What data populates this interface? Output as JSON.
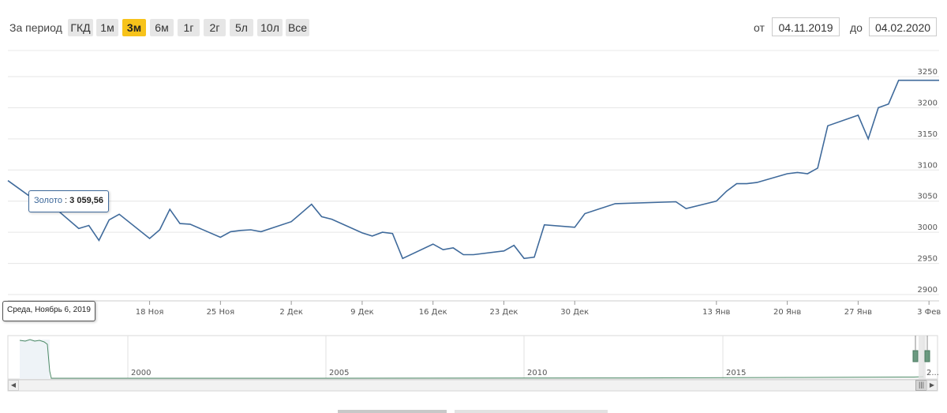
{
  "toolbar": {
    "period_label": "За период",
    "ranges": [
      {
        "label": "ГКД",
        "active": false
      },
      {
        "label": "1м",
        "active": false
      },
      {
        "label": "3м",
        "active": true
      },
      {
        "label": "6м",
        "active": false
      },
      {
        "label": "1г",
        "active": false
      },
      {
        "label": "2г",
        "active": false
      },
      {
        "label": "5л",
        "active": false
      },
      {
        "label": "10л",
        "active": false
      },
      {
        "label": "Все",
        "active": false
      }
    ],
    "from_label": "от",
    "from_value": "04.11.2019",
    "to_label": "до",
    "to_value": "04.02.2020"
  },
  "tooltip": {
    "series_name": "Золото",
    "separator": " : ",
    "value": "3 059,56",
    "date": "Среда, Ноябрь 6, 2019"
  },
  "colors": {
    "line": "#3f6a9b",
    "active_button": "#f7c31a",
    "navigator_line": "#4d8a67"
  },
  "chart_data": {
    "type": "line",
    "series": [
      {
        "name": "Золото",
        "x": [
          "04.11.2019",
          "06.11.2019",
          "07.11.2019",
          "08.11.2019",
          "11.11.2019",
          "12.11.2019",
          "13.11.2019",
          "14.11.2019",
          "15.11.2019",
          "18.11.2019",
          "19.11.2019",
          "20.11.2019",
          "21.11.2019",
          "22.11.2019",
          "25.11.2019",
          "26.11.2019",
          "27.11.2019",
          "28.11.2019",
          "29.11.2019",
          "02.12.2019",
          "03.12.2019",
          "04.12.2019",
          "05.12.2019",
          "06.12.2019",
          "09.12.2019",
          "10.12.2019",
          "11.12.2019",
          "12.12.2019",
          "13.12.2019",
          "16.12.2019",
          "17.12.2019",
          "18.12.2019",
          "19.12.2019",
          "20.12.2019",
          "23.12.2019",
          "24.12.2019",
          "25.12.2019",
          "26.12.2019",
          "27.12.2019",
          "30.12.2019",
          "31.12.2019",
          "03.01.2020",
          "09.01.2020",
          "10.01.2020",
          "13.01.2020",
          "14.01.2020",
          "15.01.2020",
          "16.01.2020",
          "17.01.2020",
          "20.01.2020",
          "21.01.2020",
          "22.01.2020",
          "23.01.2020",
          "24.01.2020",
          "27.01.2020",
          "28.01.2020",
          "29.01.2020",
          "30.01.2020",
          "31.01.2020",
          "03.02.2020",
          "04.02.2020"
        ],
        "values": [
          3083,
          3059.56,
          3052,
          3048,
          3006,
          3011,
          2987,
          3020,
          3029,
          2990,
          3004,
          3037,
          3014,
          3013,
          2992,
          3001,
          3003,
          3004,
          3001,
          3017,
          3031,
          3045,
          3025,
          3021,
          2999,
          2994,
          3000,
          2998,
          2958,
          2981,
          2972,
          2975,
          2964,
          2964,
          2970,
          2979,
          2958,
          2960,
          3012,
          3008,
          3030,
          3046,
          3049,
          3038,
          3050,
          3066,
          3078,
          3078,
          3080,
          3094,
          3096,
          3094,
          3103,
          3171,
          3188,
          3150,
          3200,
          3206,
          3244,
          3244,
          3244
        ]
      }
    ],
    "x_tick_labels": [
      "18 Ноя",
      "25 Ноя",
      "2 Дек",
      "9 Дек",
      "16 Дек",
      "23 Дек",
      "30 Дек",
      "13 Янв",
      "20 Янв",
      "27 Янв",
      "3 Фев"
    ],
    "y_ticks": [
      2900,
      2950,
      3000,
      3050,
      3100,
      3150,
      3200,
      3250
    ],
    "ylim": [
      2900,
      3250
    ],
    "grid": true,
    "legend": "none",
    "navigator": {
      "year_labels": [
        "2000",
        "2005",
        "2010",
        "2015",
        "2..."
      ],
      "window": "last 3 months"
    }
  }
}
